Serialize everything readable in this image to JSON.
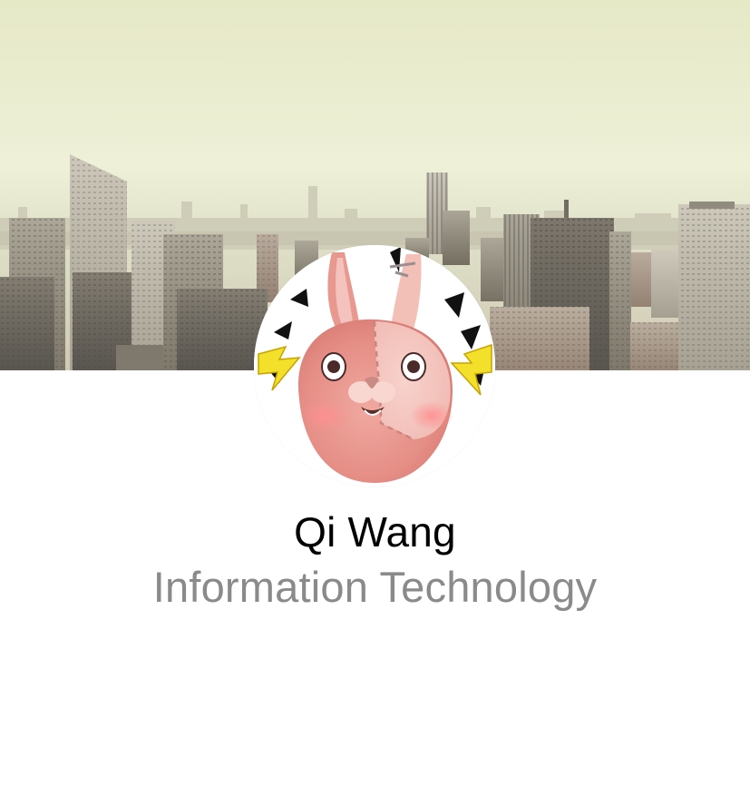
{
  "profile": {
    "name": "Qi Wang",
    "department": "Information Technology"
  },
  "cover": {
    "image": "city-skyline-photo"
  },
  "avatar": {
    "image": "pink-rabbit-character"
  },
  "colors": {
    "name_text": "#000000",
    "department_text": "#8a8a8a",
    "sky": "#eef0d6"
  }
}
